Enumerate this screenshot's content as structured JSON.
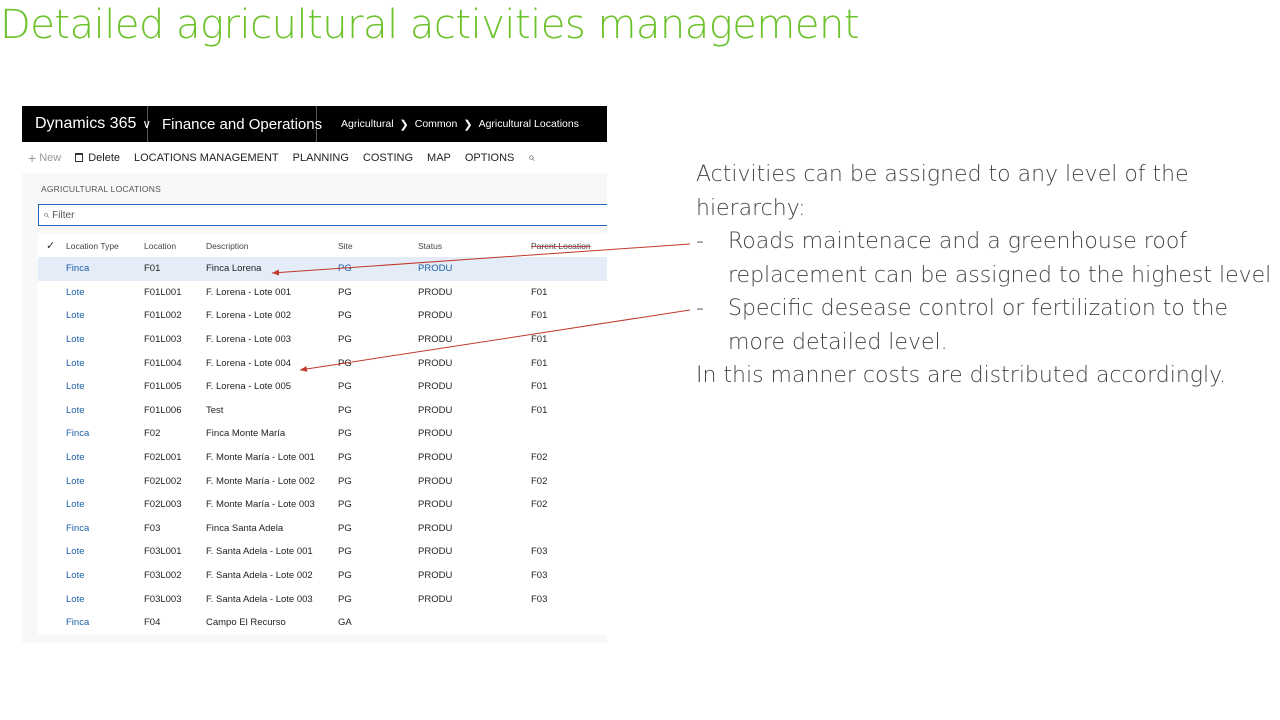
{
  "slide": {
    "title": "Detailed agricultural activities management"
  },
  "navbar": {
    "brand": "Dynamics 365",
    "module": "Finance and Operations",
    "breadcrumb": [
      "Agricultural",
      "Common",
      "Agricultural Locations"
    ]
  },
  "actionbar": {
    "new": "New",
    "delete": "Delete",
    "locations_management": "LOCATIONS MANAGEMENT",
    "planning": "PLANNING",
    "costing": "COSTING",
    "map": "MAP",
    "options": "OPTIONS"
  },
  "page": {
    "caption": "AGRICULTURAL LOCATIONS",
    "filter_placeholder": "Filter"
  },
  "grid": {
    "headers": {
      "location_type": "Location Type",
      "location": "Location",
      "description": "Description",
      "site": "Site",
      "status": "Status",
      "parent": "Parent Location"
    },
    "rows": [
      {
        "type": "Finca",
        "location": "F01",
        "description": "Finca Lorena",
        "site": "PG",
        "status": "PRODU",
        "parent": ""
      },
      {
        "type": "Lote",
        "location": "F01L001",
        "description": "F. Lorena - Lote 001",
        "site": "PG",
        "status": "PRODU",
        "parent": "F01"
      },
      {
        "type": "Lote",
        "location": "F01L002",
        "description": "F. Lorena - Lote 002",
        "site": "PG",
        "status": "PRODU",
        "parent": "F01"
      },
      {
        "type": "Lote",
        "location": "F01L003",
        "description": "F. Lorena - Lote 003",
        "site": "PG",
        "status": "PRODU",
        "parent": "F01"
      },
      {
        "type": "Lote",
        "location": "F01L004",
        "description": "F. Lorena - Lote 004",
        "site": "PG",
        "status": "PRODU",
        "parent": "F01"
      },
      {
        "type": "Lote",
        "location": "F01L005",
        "description": "F. Lorena - Lote 005",
        "site": "PG",
        "status": "PRODU",
        "parent": "F01"
      },
      {
        "type": "Lote",
        "location": "F01L006",
        "description": "Test",
        "site": "PG",
        "status": "PRODU",
        "parent": "F01"
      },
      {
        "type": "Finca",
        "location": "F02",
        "description": "Finca Monte María",
        "site": "PG",
        "status": "PRODU",
        "parent": ""
      },
      {
        "type": "Lote",
        "location": "F02L001",
        "description": "F. Monte María - Lote 001",
        "site": "PG",
        "status": "PRODU",
        "parent": "F02"
      },
      {
        "type": "Lote",
        "location": "F02L002",
        "description": "F. Monte María - Lote 002",
        "site": "PG",
        "status": "PRODU",
        "parent": "F02"
      },
      {
        "type": "Lote",
        "location": "F02L003",
        "description": "F. Monte María - Lote 003",
        "site": "PG",
        "status": "PRODU",
        "parent": "F02"
      },
      {
        "type": "Finca",
        "location": "F03",
        "description": "Finca Santa Adela",
        "site": "PG",
        "status": "PRODU",
        "parent": ""
      },
      {
        "type": "Lote",
        "location": "F03L001",
        "description": "F. Santa Adela - Lote 001",
        "site": "PG",
        "status": "PRODU",
        "parent": "F03"
      },
      {
        "type": "Lote",
        "location": "F03L002",
        "description": "F. Santa Adela - Lote 002",
        "site": "PG",
        "status": "PRODU",
        "parent": "F03"
      },
      {
        "type": "Lote",
        "location": "F03L003",
        "description": "F. Santa Adela - Lote 003",
        "site": "PG",
        "status": "PRODU",
        "parent": "F03"
      },
      {
        "type": "Finca",
        "location": "F04",
        "description": "Campo El Recurso",
        "site": "GA",
        "status": "",
        "parent": ""
      }
    ]
  },
  "annotation": {
    "intro": [
      "Activities can be assigned to any level of the",
      "hierarchy:"
    ],
    "bullets": [
      {
        "dash": "-",
        "lines": [
          "Roads maintenace and a greenhouse roof",
          "replacement can be assigned to the highest level"
        ]
      },
      {
        "dash": "-",
        "lines": [
          "Specific desease control or fertilization to the",
          "more detailed level."
        ]
      }
    ],
    "outro": "In this manner costs are distributed accordingly."
  },
  "colors": {
    "title_green": "#6cc22a",
    "navbar_bg": "#000000",
    "link_blue": "#1d5fa8",
    "selected_row": "#e4ecf7",
    "arrow_red": "#c0392b"
  }
}
